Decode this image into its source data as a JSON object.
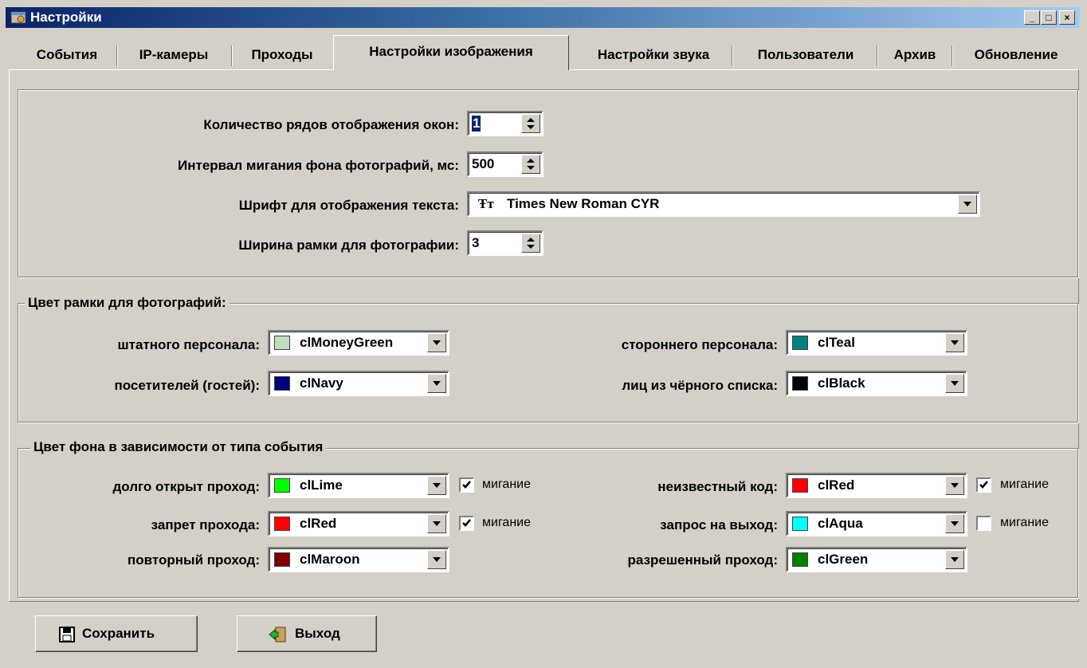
{
  "window": {
    "title": "Настройки",
    "minimize": "_",
    "maximize": "□",
    "close": "×"
  },
  "tabs": [
    {
      "label": "События"
    },
    {
      "label": "IP-камеры"
    },
    {
      "label": "Проходы"
    },
    {
      "label": "Настройки изображения"
    },
    {
      "label": "Настройки звука"
    },
    {
      "label": "Пользователи"
    },
    {
      "label": "Архив"
    },
    {
      "label": "Обновление"
    }
  ],
  "display": {
    "rows_label": "Количество рядов отображения окон:",
    "rows_value": "1",
    "blink_label": "Интервал мигания фона фотографий, мс:",
    "blink_value": "500",
    "font_label": "Шрифт для отображения текста:",
    "font_value": "Times New Roman CYR",
    "border_label": "Ширина рамки для фотографии:",
    "border_value": "3"
  },
  "frame_colors": {
    "title": "Цвет рамки для фотографий:",
    "staff_label": "штатного персонала:",
    "staff_value": "clMoneyGreen",
    "staff_color": "#c0dcc0",
    "visitors_label": "посетителей (гостей):",
    "visitors_value": "clNavy",
    "visitors_color": "#000080",
    "external_label": "стороннего персонала:",
    "external_value": "clTeal",
    "external_color": "#008080",
    "blacklist_label": "лиц из чёрного списка:",
    "blacklist_value": "clBlack",
    "blacklist_color": "#000000"
  },
  "event_colors": {
    "title": "Цвет фона в зависимости от типа события",
    "blink_text": "мигание",
    "long_open_label": "долго открыт проход:",
    "long_open_value": "clLime",
    "long_open_color": "#00ff00",
    "long_open_blink": true,
    "deny_label": "запрет прохода:",
    "deny_value": "clRed",
    "deny_color": "#ff0000",
    "deny_blink": true,
    "repeat_label": "повторный проход:",
    "repeat_value": "clMaroon",
    "repeat_color": "#800000",
    "unknown_label": "неизвестный код:",
    "unknown_value": "clRed",
    "unknown_color": "#ff0000",
    "unknown_blink": true,
    "exit_req_label": "запрос на выход:",
    "exit_req_value": "clAqua",
    "exit_req_color": "#00ffff",
    "exit_req_blink": false,
    "allowed_label": "разрешенный проход:",
    "allowed_value": "clGreen",
    "allowed_color": "#008000"
  },
  "buttons": {
    "save": "Сохранить",
    "exit": "Выход"
  }
}
